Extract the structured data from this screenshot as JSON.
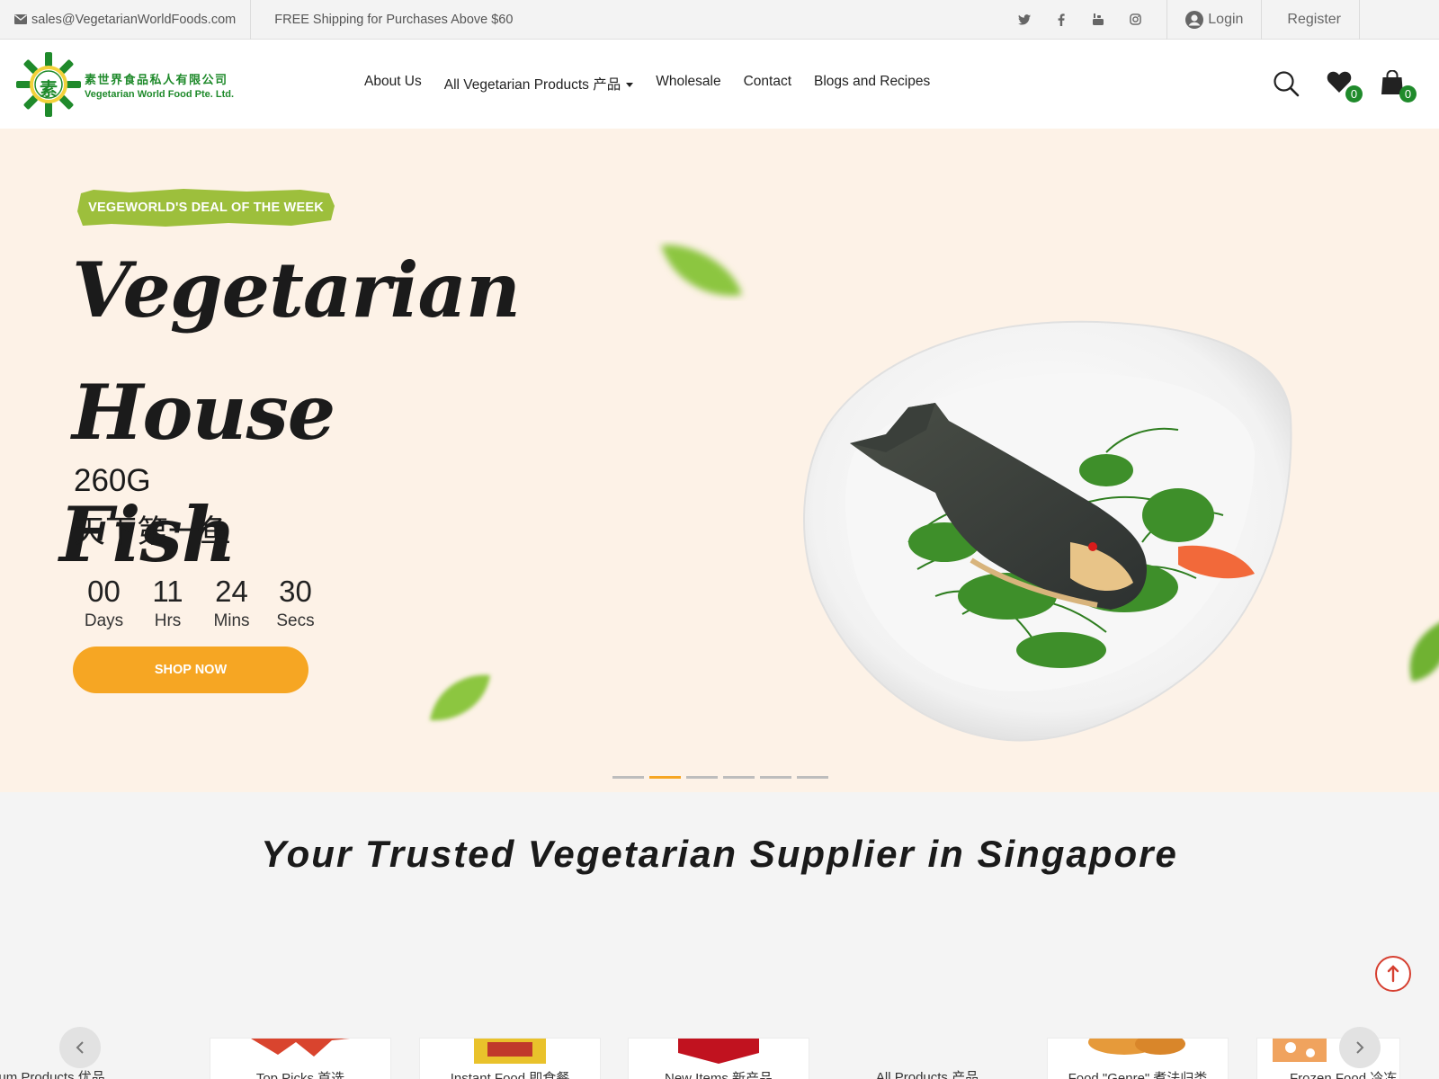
{
  "topbar": {
    "email": "sales@VegetarianWorldFoods.com",
    "shipping": "FREE Shipping for Purchases Above $60",
    "social": [
      "twitter-icon",
      "facebook-icon",
      "youtube-icon",
      "instagram-icon"
    ],
    "login": "Login",
    "register": "Register"
  },
  "header": {
    "logo_cn": "素世界食品私人有限公司",
    "logo_en": "Vegetarian World Food Pte. Ltd.",
    "logo_mark": "素",
    "nav": [
      "About Us",
      "All Vegetarian Products 产品",
      "Wholesale",
      "Contact",
      "Blogs and Recipes"
    ],
    "wishlist_count": "0",
    "cart_count": "0"
  },
  "hero": {
    "tag": "VEGEWORLD'S DEAL OF THE WEEK",
    "title_line1": "Vegetarian House",
    "title_line2": "Fish",
    "weight": "260G",
    "chinese_name": "天下第一鱼",
    "countdown": [
      {
        "value": "00",
        "label": "Days"
      },
      {
        "value": "11",
        "label": "Hrs"
      },
      {
        "value": "24",
        "label": "Mins"
      },
      {
        "value": "30",
        "label": "Secs"
      }
    ],
    "cta": "SHOP NOW",
    "slides_total": 6,
    "active_slide": 2
  },
  "section": {
    "title": "Your Trusted Vegetarian Supplier in Singapore"
  },
  "categories": [
    "Premium Products 优品",
    "Top Picks 首选",
    "Instant Food 即食餐",
    "New Items 新产品",
    "All Products 产品",
    "Food \"Genre\" 煮法归类",
    "Frozen Food 冷冻"
  ],
  "colors": {
    "brand_green": "#1f8a2b",
    "accent_orange": "#f6a623",
    "hero_bg": "#fdf2e7",
    "tag_green": "#9dbf3c"
  }
}
